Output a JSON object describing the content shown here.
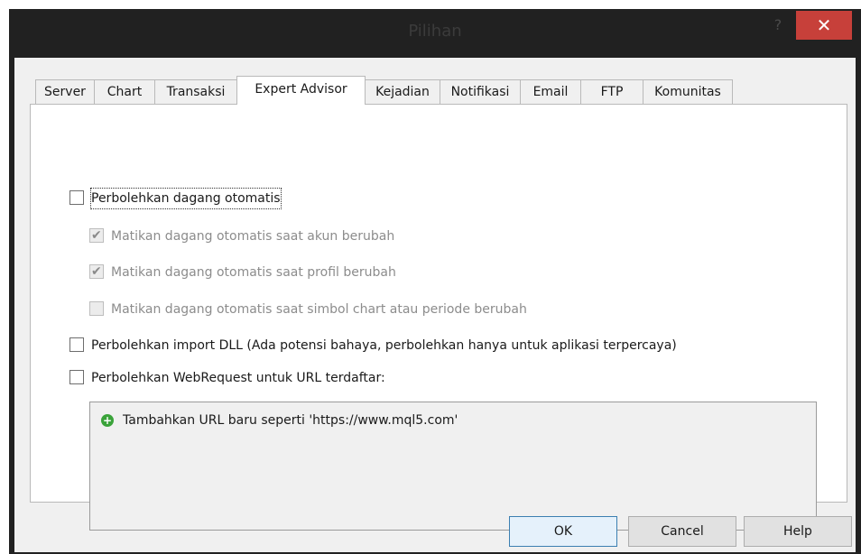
{
  "window": {
    "title": "Pilihan",
    "help_glyph": "?",
    "close_glyph": "✕"
  },
  "tabs": [
    {
      "label": "Server"
    },
    {
      "label": "Chart"
    },
    {
      "label": "Transaksi"
    },
    {
      "label": "Expert Advisor",
      "active": true
    },
    {
      "label": "Kejadian"
    },
    {
      "label": "Notifikasi"
    },
    {
      "label": "Email"
    },
    {
      "label": "FTP"
    },
    {
      "label": "Komunitas"
    }
  ],
  "options": {
    "allow_auto_trading": {
      "label": "Perbolehkan dagang otomatis",
      "checked": false
    },
    "disable_on_account_change": {
      "label": "Matikan dagang otomatis saat akun berubah",
      "checked": true,
      "enabled": false
    },
    "disable_on_profile_change": {
      "label": "Matikan dagang otomatis saat profil berubah",
      "checked": true,
      "enabled": false
    },
    "disable_on_symbol_change": {
      "label": "Matikan dagang otomatis saat simbol chart atau periode berubah",
      "checked": false,
      "enabled": false
    },
    "allow_dll_import": {
      "label": "Perbolehkan import DLL (Ada potensi bahaya, perbolehkan hanya untuk aplikasi terpercaya)",
      "checked": false
    },
    "allow_webrequest": {
      "label": "Perbolehkan WebRequest untuk URL terdaftar:",
      "checked": false
    }
  },
  "url_list": {
    "add_label": "Tambahkan URL baru seperti 'https://www.mql5.com'",
    "icon": "plus-circle-icon"
  },
  "buttons": {
    "ok": "OK",
    "cancel": "Cancel",
    "help": "Help"
  },
  "colors": {
    "titlebar": "#212121",
    "close_button": "#c7403a",
    "add_icon": "#3aa33a"
  }
}
